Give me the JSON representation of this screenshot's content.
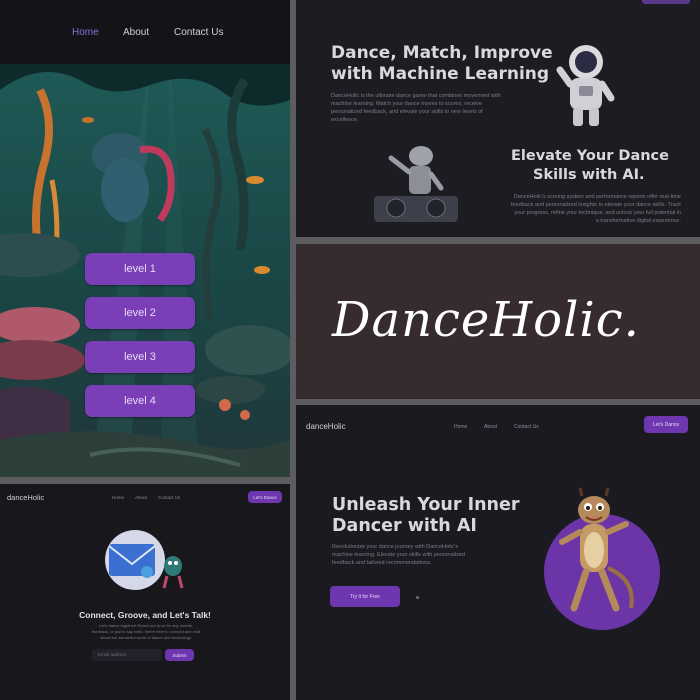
{
  "game": {
    "nav": [
      "Home",
      "About",
      "Contact Us"
    ],
    "levels": [
      "level 1",
      "level 2",
      "level 3",
      "level 4"
    ]
  },
  "ml": {
    "headline1": "Dance, Match, Improve",
    "headline2": "with Machine Learning",
    "body1": "DanceHolic is the ultimate dance game that combines movement with machine learning. Match your dance moves to scores, receive personalized feedback, and elevate your skills to new levels of excellence.",
    "headline3": "Elevate Your Dance",
    "headline4": "Skills with AI.",
    "body2": "DanceHolic's scoring system and performance reports offer real-time feedback and personalized insights to elevate your dance skills. Track your progress, refine your technique, and unlock your full potential in a transformative digital experience."
  },
  "title": {
    "logo": "DanceHolic."
  },
  "contact": {
    "brand": "danceHolic",
    "nav": [
      "Home",
      "About",
      "Contact Us"
    ],
    "cta": "Let's Dance",
    "heading": "Connect, Groove, and Let's Talk!",
    "body": "Let's dance together! Reach out to us for any doubts, feedback, or just to say hello. We're here to connect and chat about the wonderful world of dance and technology.",
    "email_placeholder": "Email address",
    "submit": "Submit"
  },
  "hero": {
    "brand": "danceHolic",
    "nav": [
      "Home",
      "About",
      "Contact Us"
    ],
    "cta": "Let's Dance",
    "headline1": "Unleash Your Inner",
    "headline2": "Dancer with AI",
    "body": "Revolutionize your dance journey with DanceHolic's machine learning. Elevate your skills with personalized feedback and tailored recommendations.",
    "try_button": "Try it for Free"
  },
  "colors": {
    "accent": "#7a3fb8",
    "title_bg": "#362b2f",
    "panel_bg": "#1c1c22",
    "gap": "#5d5d60"
  }
}
